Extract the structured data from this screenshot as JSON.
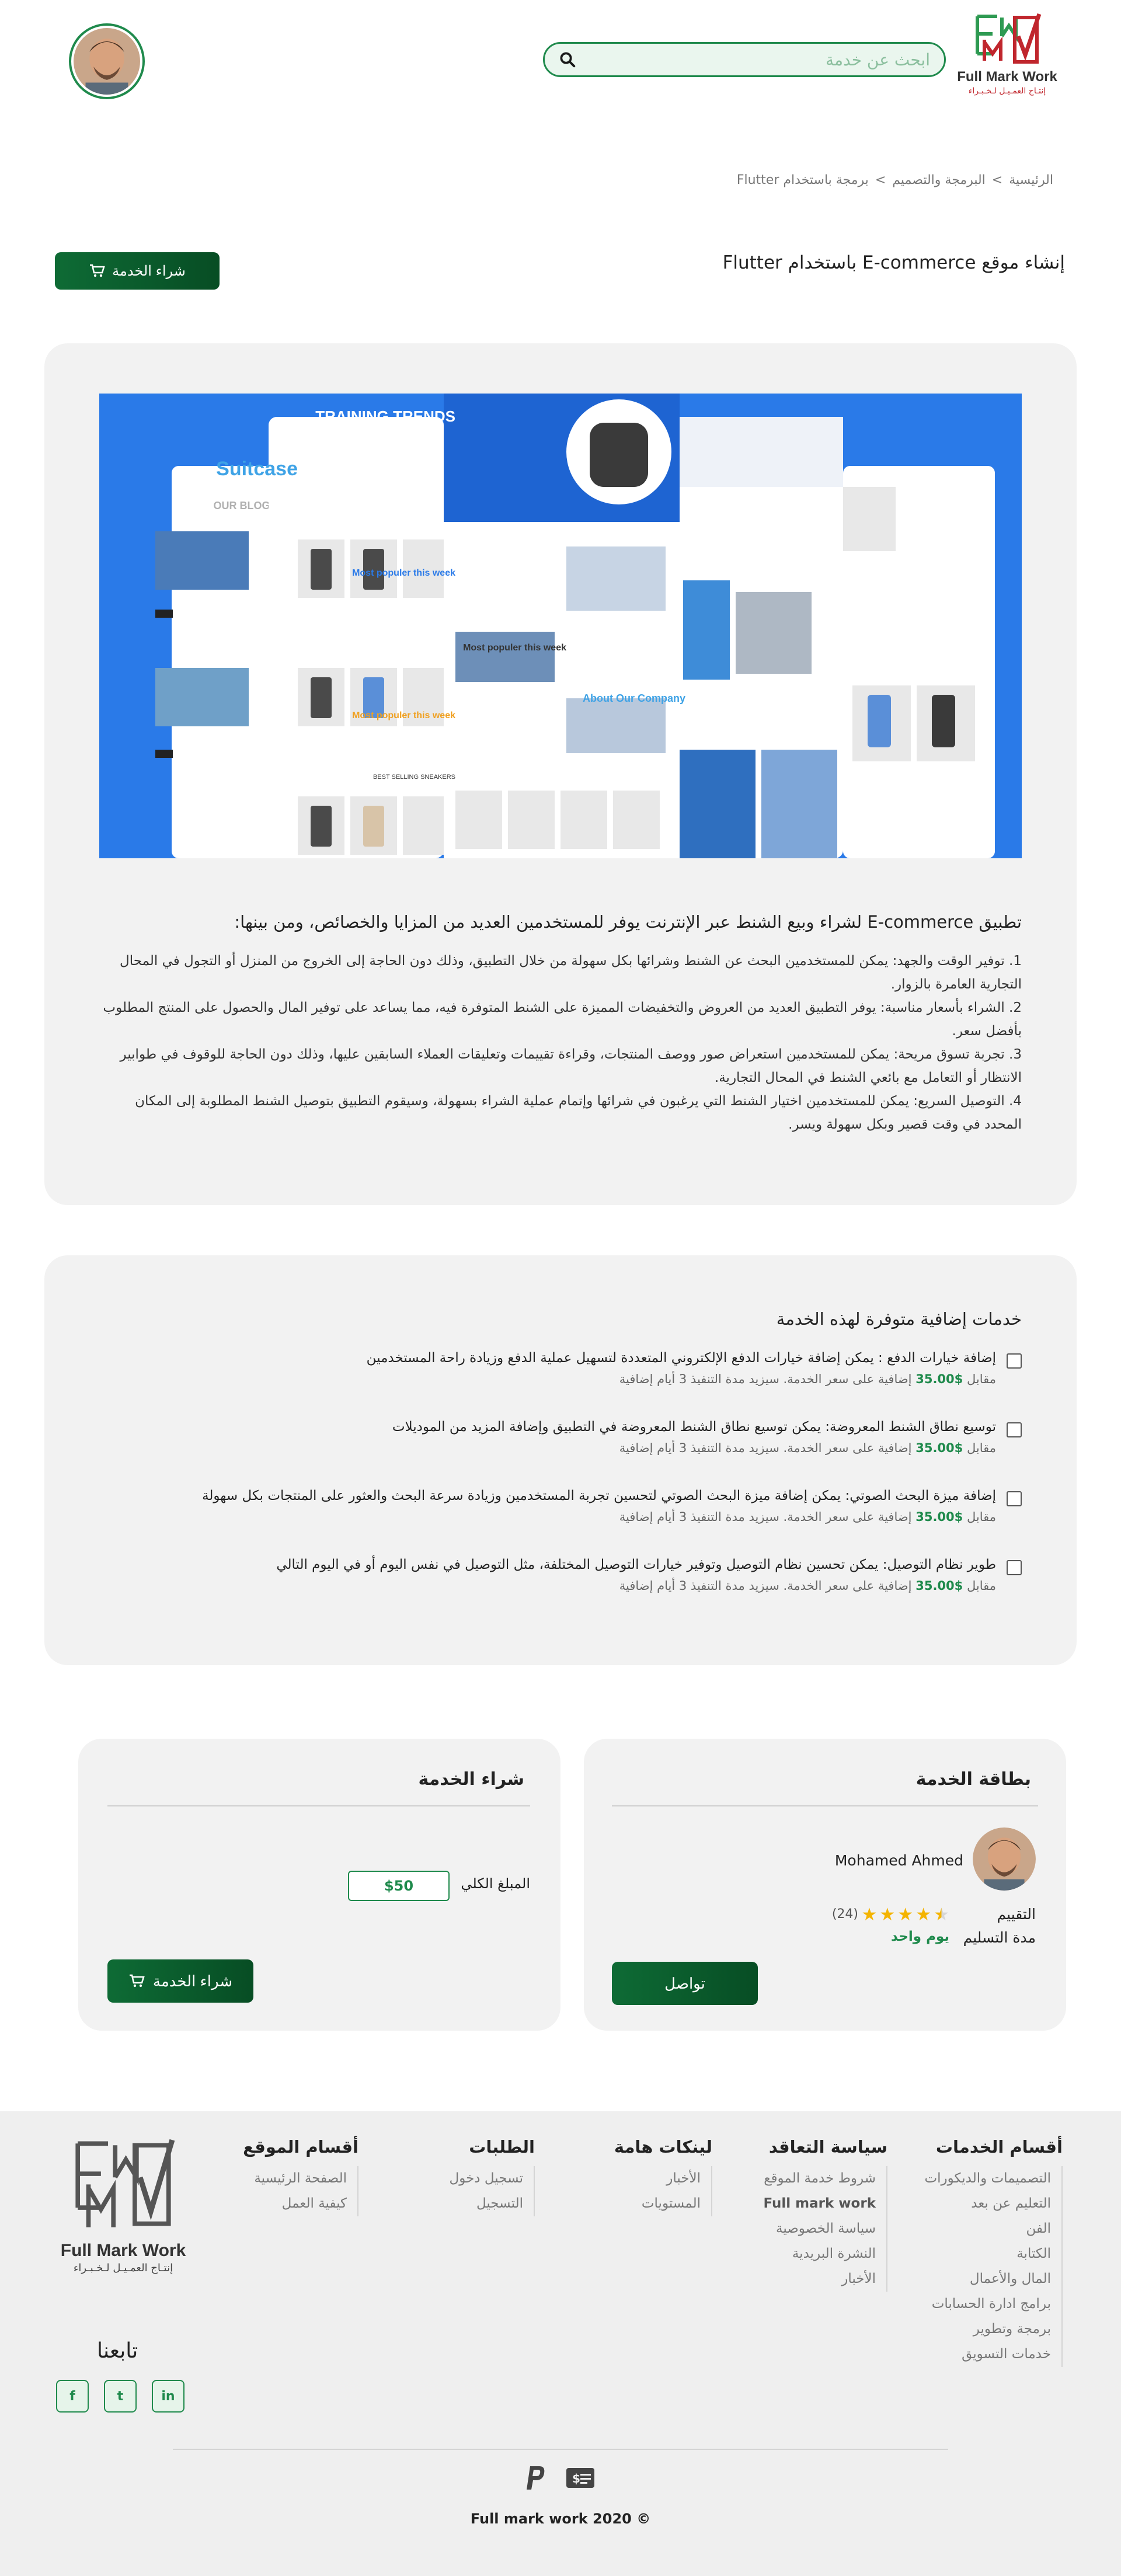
{
  "header": {
    "logo_text": "Full Mark Work",
    "logo_subtext": "إنتـاج العمـيـل لـخـبـراء",
    "search_placeholder": "ابحث عن خدمة"
  },
  "breadcrumb": {
    "items": [
      "الرئيسية",
      "البرمجة والتصميم",
      "برمجة باستخدام Flutter"
    ],
    "separator": ">"
  },
  "page": {
    "title": "إنشاء موقع E-commerce باستخدام Flutter",
    "buy_label": "شراء الخدمة"
  },
  "hero": {
    "panel_title": "TRAINING TRENDS",
    "brand": "Suitcase",
    "most_popular": "Most populer this week",
    "blog": "OUR BLOG",
    "about": "About Our Company",
    "best_selling": "BEST SELLING SNEAKERS"
  },
  "description": {
    "title": "تطبيق E-commerce لشراء وبيع الشنط عبر الإنترنت يوفر للمستخدمين العديد من المزايا والخصائص، ومن بينها:",
    "items": [
      "1. توفير الوقت والجهد: يمكن للمستخدمين البحث عن الشنط وشرائها بكل سهولة من خلال التطبيق، وذلك دون الحاجة إلى الخروج من المنزل أو التجول في المحال التجارية العامرة بالزوار.",
      "2. الشراء بأسعار مناسبة: يوفر التطبيق العديد من العروض والتخفيضات المميزة على الشنط المتوفرة فيه، مما يساعد على توفير المال والحصول على المنتج المطلوب بأفضل سعر.",
      "3. تجربة تسوق مريحة: يمكن للمستخدمين استعراض صور ووصف المنتجات، وقراءة تقييمات وتعليقات العملاء السابقين عليها، وذلك دون الحاجة للوقوف في طوابير الانتظار أو التعامل مع بائعي الشنط في المحال التجارية.",
      "4. التوصيل السريع: يمكن للمستخدمين اختيار الشنط التي يرغبون في شرائها وإتمام عملية الشراء بسهولة، وسيقوم التطبيق بتوصيل الشنط المطلوبة إلى المكان المحدد في وقت قصير وبكل سهولة ويسر."
    ]
  },
  "addons": {
    "title": "خدمات إضافية متوفرة لهذه الخدمة",
    "meta_prefix": "مقابل",
    "meta_suffix": "إضافية على سعر الخدمة. سيزيد مدة التنفيذ 3 أيام إضافية",
    "items": [
      {
        "title": "إضافة خيارات الدفع : يمكن إضافة خيارات الدفع الإلكتروني المتعددة لتسهيل عملية الدفع وزيادة راحة المستخدمين",
        "price": "$35.00"
      },
      {
        "title": "توسيع نطاق الشنط المعروضة: يمكن توسيع نطاق الشنط المعروضة في التطبيق وإضافة المزيد من الموديلات",
        "price": "$35.00"
      },
      {
        "title": "إضافة ميزة البحث الصوتي: يمكن إضافة ميزة البحث الصوتي لتحسين تجربة المستخدمين وزيادة سرعة البحث والعثور على المنتجات بكل سهولة",
        "price": "$35.00"
      },
      {
        "title": "طوير نظام التوصيل: يمكن تحسين نظام التوصيل وتوفير خيارات التوصيل المختلفة، مثل التوصيل في نفس اليوم أو في اليوم التالي",
        "price": "$35.00"
      }
    ]
  },
  "service_card": {
    "title": "بطاقة الخدمة",
    "seller_name": "Mohamed Ahmed",
    "rating_label": "التقييم",
    "rating_value": 4.5,
    "rating_count": "(24)",
    "delivery_label": "مدة التسليم",
    "delivery_value": "يوم واحد",
    "contact_label": "تواصل"
  },
  "purchase_card": {
    "title": "شراء الخدمة",
    "total_label": "المبلغ الكلي",
    "total_value": "$50",
    "buy_label": "شراء الخدمة"
  },
  "footer": {
    "columns": [
      {
        "title": "أقسام الخدمات",
        "links": [
          "التصميمات والديكورات",
          "التعليم عن بعد",
          "الفن",
          "الكتابة",
          "المال والأعمال",
          "برامج ادارة الحسابات",
          "برمجة وتطوير",
          "خدمات التسويق"
        ]
      },
      {
        "title": "سياسة التعاقد",
        "links": [
          "شروط خدمة الموقع",
          "Full mark work",
          "سياسة الخصوصية",
          "النشرة البريدية",
          "الأخبار"
        ]
      },
      {
        "title": "لينكات هامة",
        "links": [
          "الأخبار",
          "المستويات"
        ]
      },
      {
        "title": "الطلبات",
        "links": [
          "تسجيل دخول",
          "التسجيل"
        ]
      },
      {
        "title": "أقسام الموقع",
        "links": [
          "الصفحة الرئيسية",
          "كيفية العمل"
        ]
      }
    ],
    "logo_text": "Full Mark Work",
    "logo_subtext": "إنتـاج العمـيـل لـخـبـراء",
    "follow_title": "تابعنا",
    "socials": [
      "f",
      "t",
      "in"
    ],
    "copyright": "Full mark work 2020 ©"
  }
}
